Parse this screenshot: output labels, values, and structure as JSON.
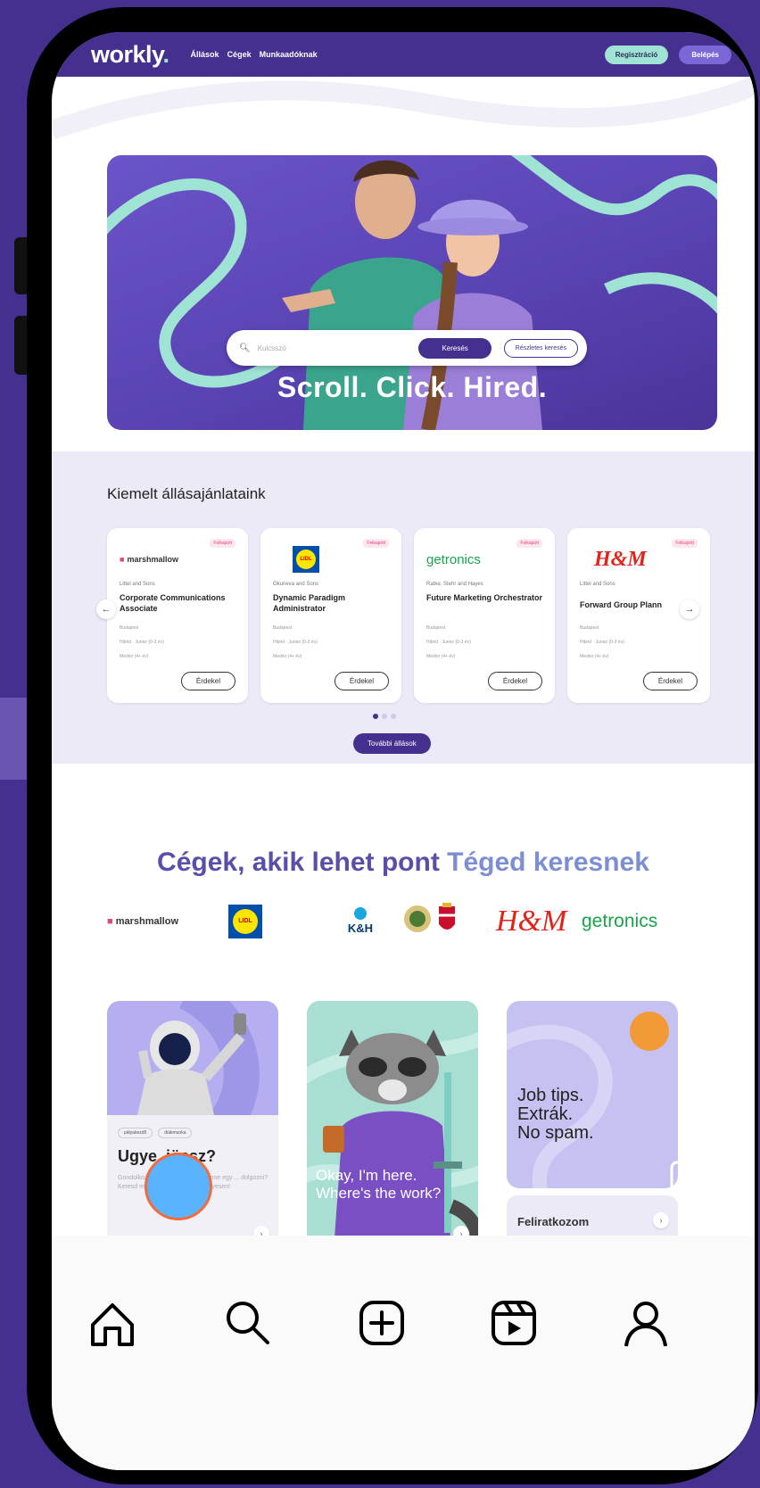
{
  "site": {
    "logo": "workly",
    "logo_dot": ".",
    "nav_links": [
      "Állások",
      "Cégek",
      "Munkaadóknak"
    ],
    "register_label": "Regisztráció",
    "login_label": "Belépés",
    "brand_color": "#45308f",
    "accent_color": "#9fe3d4"
  },
  "hero": {
    "search_placeholder": "Kulcsszó",
    "search_button": "Keresés",
    "detailed_search_button": "Részletes keresés",
    "slogan": "Scroll. Click. Hired."
  },
  "featured": {
    "title": "Kiemelt állásajánlataink",
    "more_button": "További állások",
    "cards": [
      {
        "logo": "marshmallow",
        "badge": "Felkapott",
        "company": "Littel and Sons",
        "title": "Corporate Communications Associate",
        "location": "Budapest",
        "meta1": "Hibrid · Junior (0-3 év)",
        "meta2": "Medior (4+ év)",
        "button": "Érdekel"
      },
      {
        "logo": "LIDL",
        "badge": "Felkapott",
        "company": "Okuneva and Sons",
        "title": "Dynamic Paradigm Administrator",
        "location": "Budapest",
        "meta1": "Hibrid · Junior (0-3 év)",
        "meta2": "Medior (4+ év)",
        "button": "Érdekel"
      },
      {
        "logo": "getronics",
        "badge": "Felkapott",
        "company": "Ratke, Stehr and Hayes",
        "title": "Future Marketing Orchestrator",
        "location": "Budapest",
        "meta1": "Hibrid · Junior (0-3 év)",
        "meta2": "Medior (4+ év)",
        "button": "Érdekel"
      },
      {
        "logo": "H&M",
        "badge": "Felkapott",
        "company": "Littel and Sons",
        "title": "Forward Group Plann",
        "location": "Budapest",
        "meta1": "Hibrid · Junior (0-3 év)",
        "meta2": "Medior (4+ év)",
        "button": "Érdekel"
      }
    ]
  },
  "companies": {
    "title_part1": "Cégek, akik lehet pont ",
    "title_part2": "Téged keresnek",
    "logos": [
      "marshmallow",
      "LIDL",
      "K&H",
      "H&M",
      "getronics"
    ]
  },
  "promos": {
    "card1": {
      "tags": [
        "pályakezdő",
        "diákmunka"
      ],
      "title": "Ugye, jössz?",
      "body": "Gondolkoztál már azon, milyen lenne egy ... dolgozni? Keresd meg ... dolgozókat személyesen!"
    },
    "card2": {
      "caption_line1": "Okay, I'm here.",
      "caption_line2": "Where's the work?"
    },
    "card3": {
      "text_line1": "Job tips.",
      "text_line2": "Extrák.",
      "text_line3": "No spam.",
      "subscribe": "Feliratkozom"
    }
  },
  "tabbar": {
    "items": [
      "home-icon",
      "search-icon",
      "create-icon",
      "reels-icon",
      "profile-icon"
    ]
  }
}
